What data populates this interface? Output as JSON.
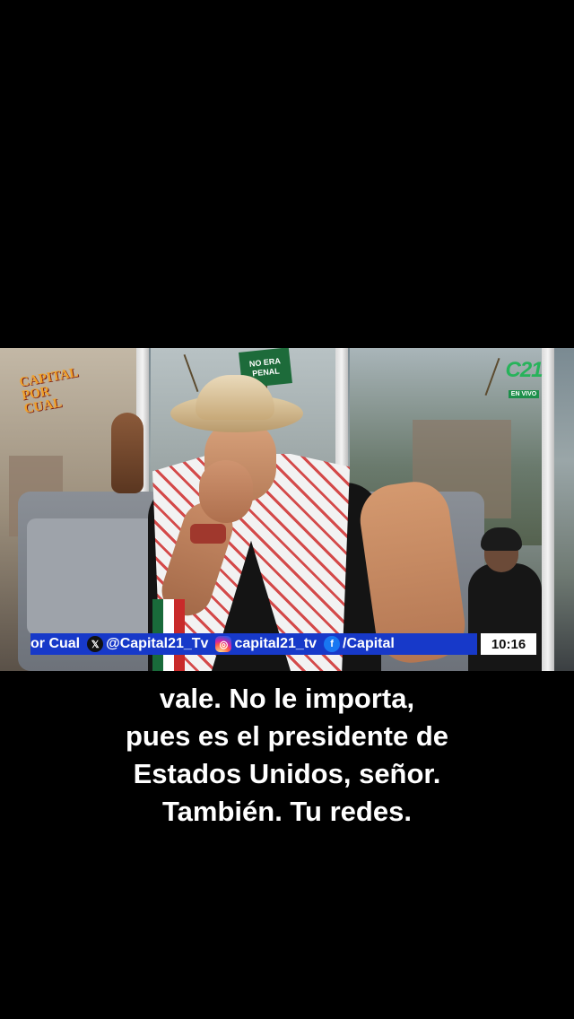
{
  "video": {
    "show_logo_line1": "CAPITAL",
    "show_logo_line2": "POR CUAL",
    "channel_logo": "C21",
    "live_label": "EN VIVO",
    "prop_sign_line1": "NO ERA",
    "prop_sign_line2": "PENAL",
    "ticker": {
      "segment_1": "or Cual",
      "x_handle": "@Capital21_Tv",
      "instagram_handle": "capital21_tv",
      "facebook_handle": "/Capital"
    },
    "clock": "10:16",
    "icons": {
      "x": "x-icon",
      "instagram": "instagram-icon",
      "facebook": "facebook-icon"
    }
  },
  "captions": {
    "line1": "vale. No le importa,",
    "line2": "pues es el presidente de",
    "line3": "Estados Unidos, señor.",
    "line4": "También. Tu redes."
  }
}
